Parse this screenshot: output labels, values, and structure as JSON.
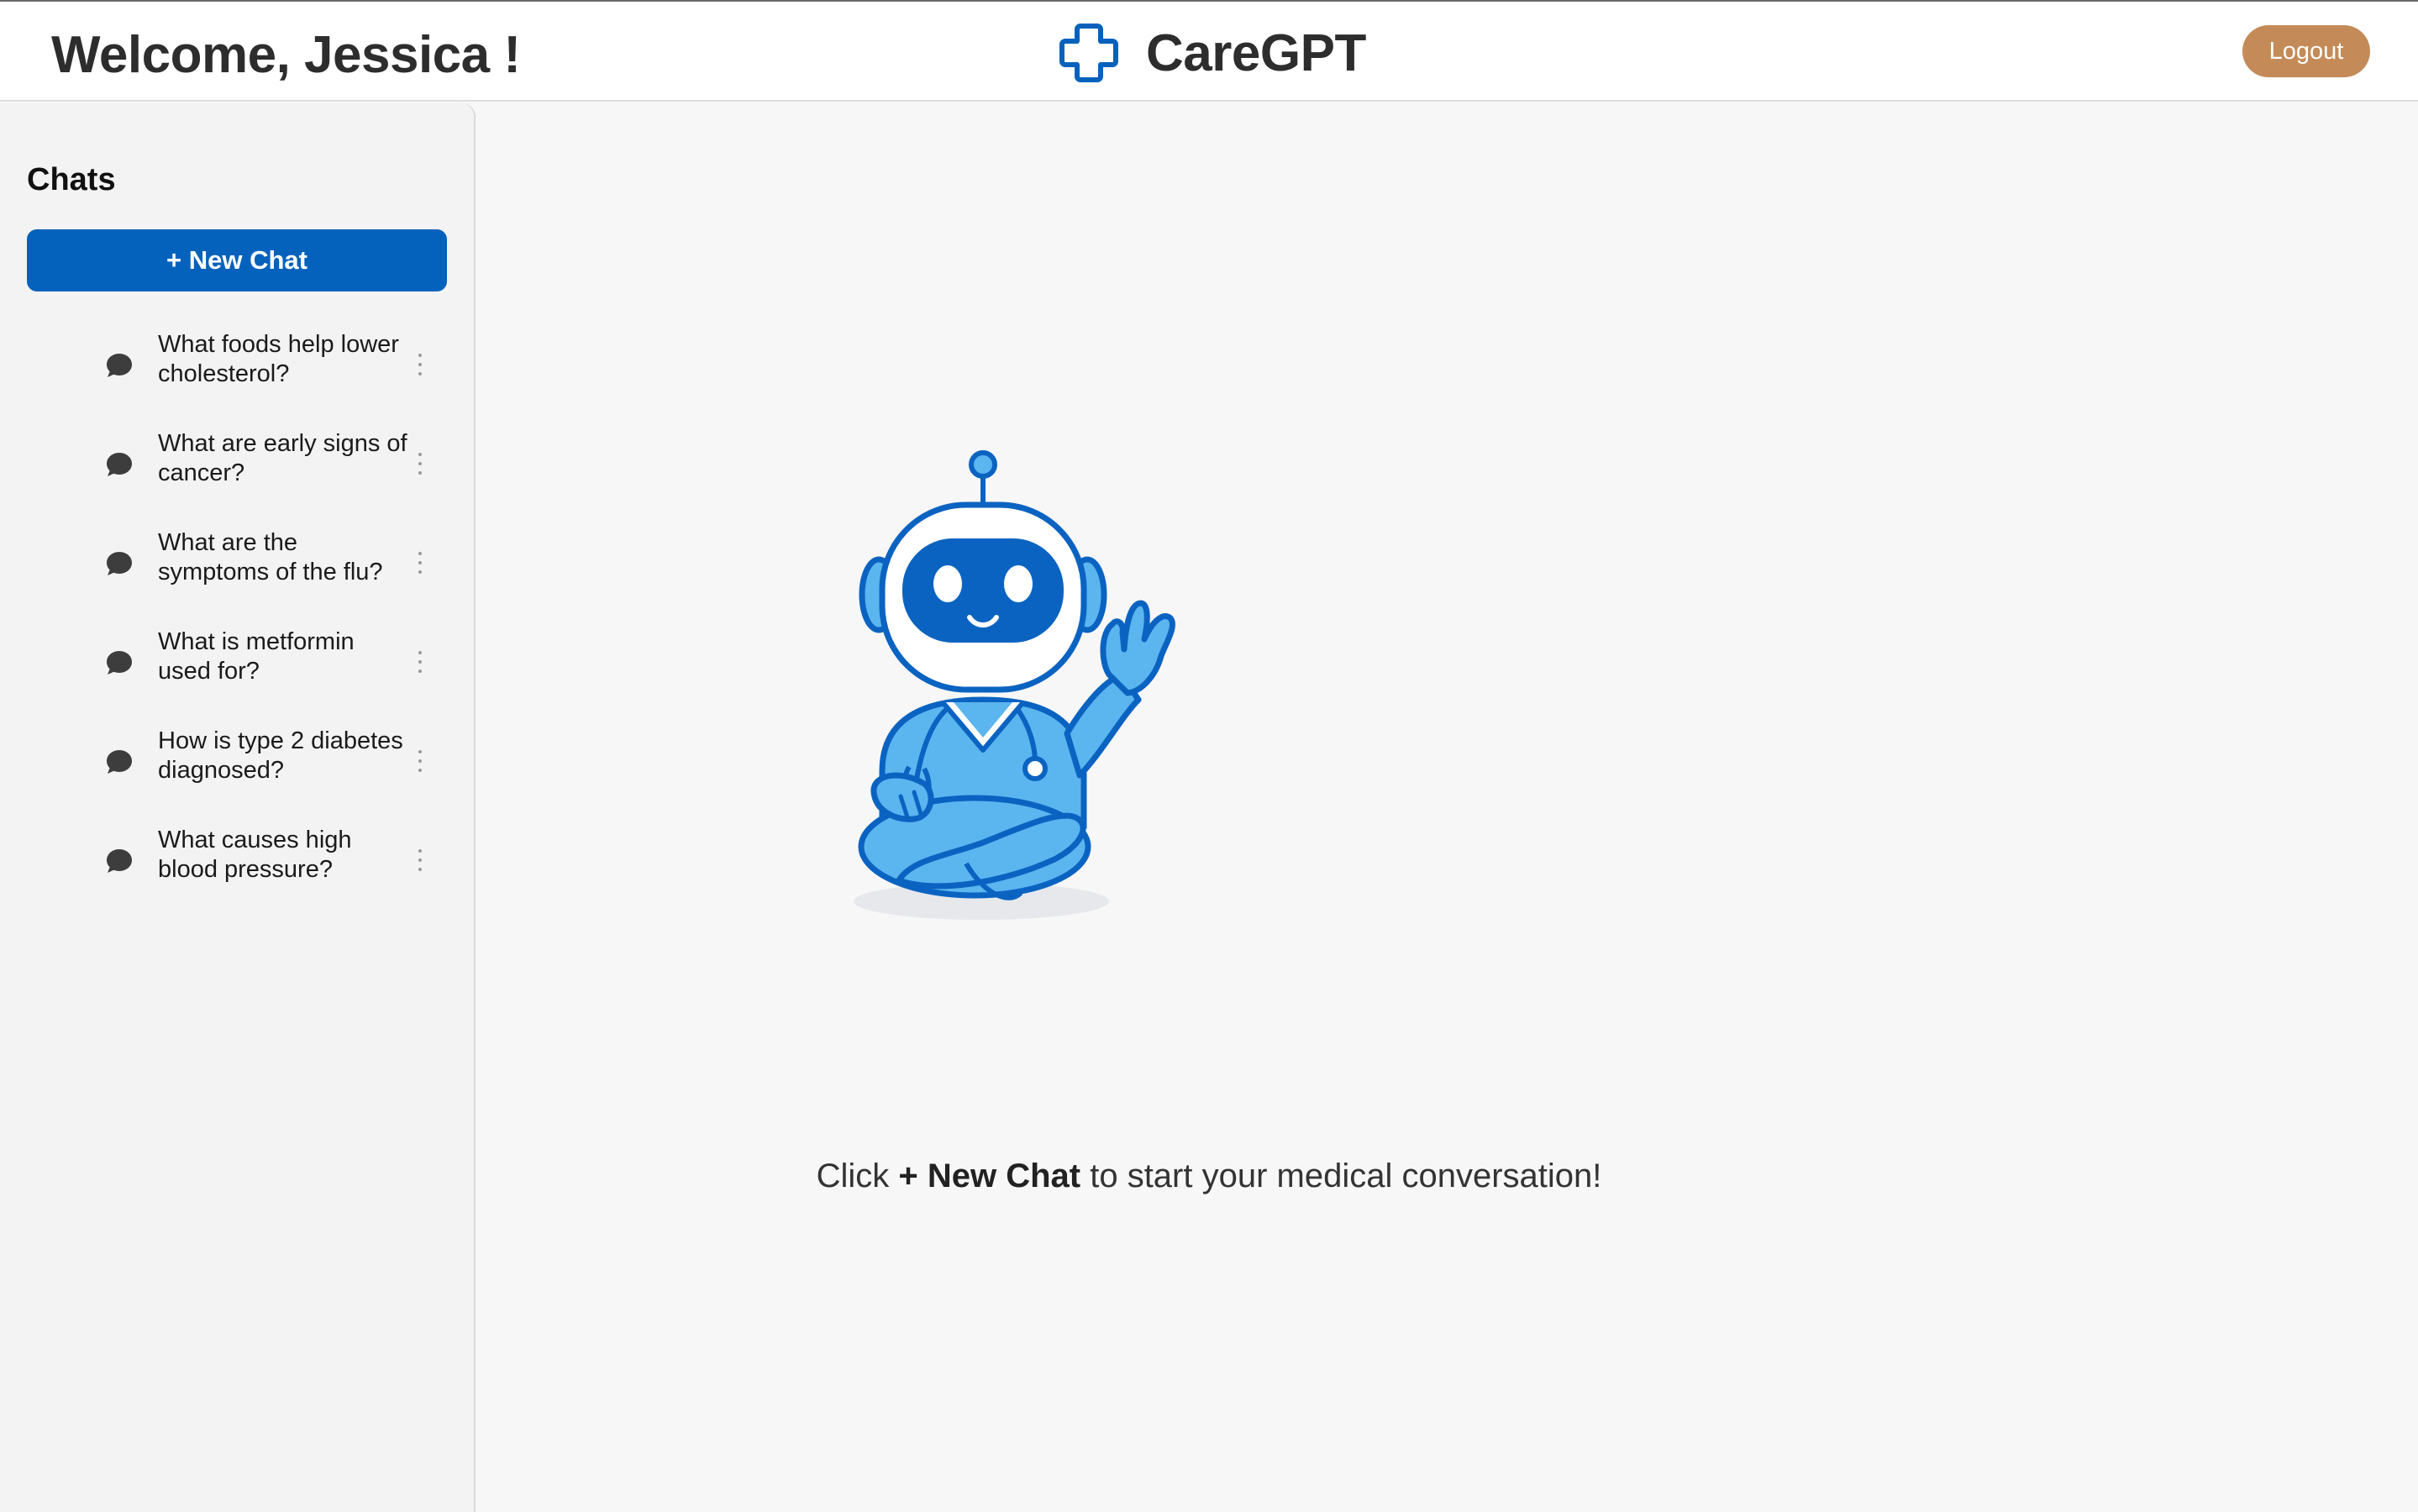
{
  "header": {
    "welcome_text": "Welcome, Jessica !",
    "app_name": "CareGPT",
    "logo_icon": "medical-cross-icon",
    "logout_label": "Logout"
  },
  "sidebar": {
    "title": "Chats",
    "new_chat_label": "+ New Chat",
    "chats": [
      {
        "title": "What foods help lower cholesterol?",
        "icon": "chat-bubble-icon"
      },
      {
        "title": "What are early signs of cancer?",
        "icon": "chat-bubble-icon"
      },
      {
        "title": "What are the symptoms of the flu?",
        "icon": "chat-bubble-icon"
      },
      {
        "title": "What is metformin used for?",
        "icon": "chat-bubble-icon"
      },
      {
        "title": "How is type 2 diabetes diagnosed?",
        "icon": "chat-bubble-icon"
      },
      {
        "title": "What causes high blood pressure?",
        "icon": "chat-bubble-icon"
      }
    ]
  },
  "main": {
    "illustration": "doctor-robot-mascot",
    "hint_prefix": "Click ",
    "hint_bold": "+ New Chat",
    "hint_suffix": " to start your medical conversation!"
  },
  "colors": {
    "primary": "#0562bc",
    "logout": "#c48b58",
    "mascot_light": "#5bb5ef",
    "mascot_dark": "#0b63c1"
  }
}
